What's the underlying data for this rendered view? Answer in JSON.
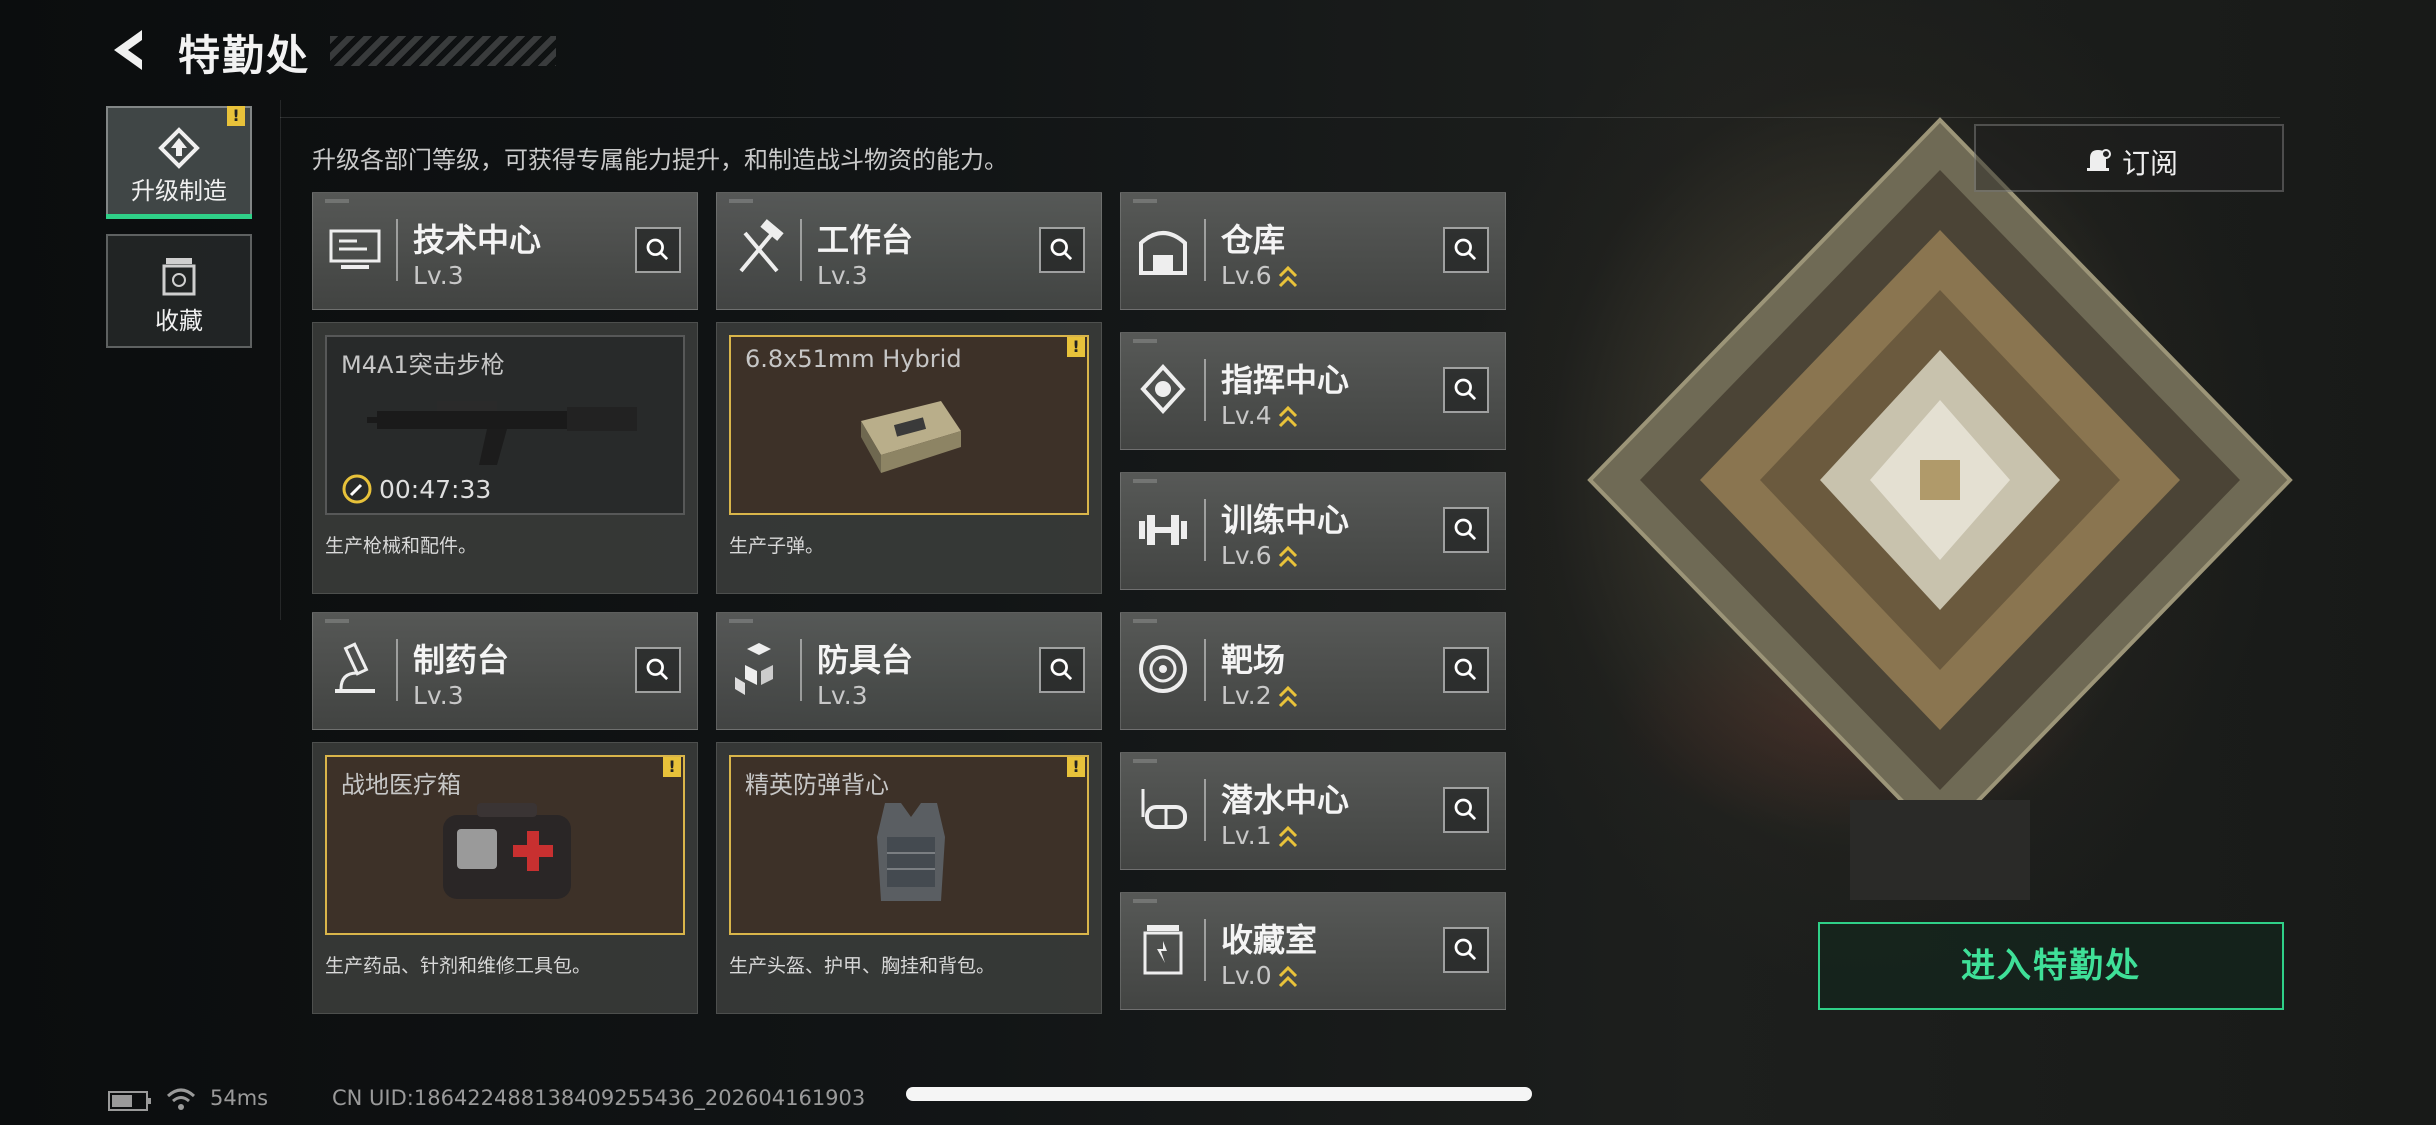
{
  "header": {
    "title": "特勤处"
  },
  "subtitle": "升级各部门等级，可获得专属能力提升，和制造战斗物资的能力。",
  "tabs": [
    {
      "label": "升级制造",
      "active": true,
      "icon": "upgrade-icon",
      "alert": "!"
    },
    {
      "label": "收藏",
      "active": false,
      "icon": "collection-icon"
    }
  ],
  "departments": {
    "tech": {
      "name": "技术中心",
      "level": "Lv.3",
      "icon": "workbench-monitor-icon"
    },
    "workbench": {
      "name": "工作台",
      "level": "Lv.3",
      "icon": "hammer-wrench-icon"
    },
    "pharmacy": {
      "name": "制药台",
      "level": "Lv.3",
      "icon": "microscope-icon"
    },
    "armor": {
      "name": "防具台",
      "level": "Lv.3",
      "icon": "armor-boxes-icon"
    },
    "warehouse": {
      "name": "仓库",
      "level": "Lv.6",
      "icon": "warehouse-icon"
    },
    "command": {
      "name": "指挥中心",
      "level": "Lv.4",
      "icon": "command-chip-icon"
    },
    "training": {
      "name": "训练中心",
      "level": "Lv.6",
      "icon": "dumbbell-icon"
    },
    "range": {
      "name": "靶场",
      "level": "Lv.2",
      "icon": "target-icon"
    },
    "diving": {
      "name": "潜水中心",
      "level": "Lv.1",
      "icon": "diving-mask-icon"
    },
    "collection": {
      "name": "收藏室",
      "level": "Lv.0",
      "icon": "trophy-jar-icon"
    }
  },
  "production": {
    "tech": {
      "item": "M4A1突击步枪",
      "timer": "00:47:33",
      "desc": "生产枪械和配件。"
    },
    "workbench": {
      "item": "6.8x51mm Hybrid",
      "desc": "生产子弹。",
      "alert": "!"
    },
    "pharmacy": {
      "item": "战地医疗箱",
      "desc": "生产药品、针剂和维修工具包。",
      "alert": "!"
    },
    "armor": {
      "item": "精英防弹背心",
      "desc": "生产头盔、护甲、胸挂和背包。",
      "alert": "!"
    }
  },
  "subscribe_label": "订阅",
  "enter_label": "进入特勤处",
  "status": {
    "ping": "54ms",
    "uid": "CN UID:186422488138409255436_202604161903"
  },
  "colors": {
    "accent_green": "#2fd088",
    "alert_yellow": "#e8c23a",
    "ready_border": "#d9b54a"
  }
}
